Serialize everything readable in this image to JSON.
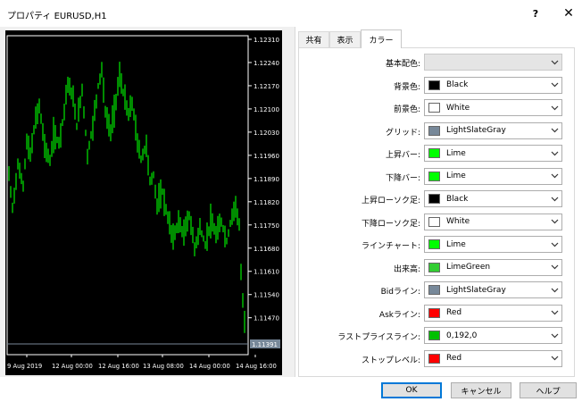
{
  "window": {
    "title": "プロパティ EURUSD,H1",
    "help_label": "?",
    "close_label": "✕"
  },
  "tabs": [
    {
      "label": "共有",
      "active": false
    },
    {
      "label": "表示",
      "active": false
    },
    {
      "label": "カラー",
      "active": true
    }
  ],
  "chart": {
    "background": "#000000",
    "bull_color": "#00ff00",
    "grid_color": "#778899",
    "price_labels": [
      "1.12310",
      "1.12240",
      "1.12170",
      "1.12100",
      "1.12030",
      "1.11960",
      "1.11890",
      "1.11820",
      "1.11750",
      "1.11680",
      "1.11610",
      "1.11540",
      "1.11470"
    ],
    "current_price": "1.11391",
    "time_labels": [
      "9 Aug 2019",
      "12 Aug 00:00",
      "12 Aug 16:00",
      "13 Aug 08:00",
      "14 Aug 00:00",
      "14 Aug 16:00"
    ]
  },
  "color_settings": [
    {
      "label": "基本配色:",
      "value": "",
      "swatch": null,
      "disabled": true
    },
    {
      "label": "背景色:",
      "value": "Black",
      "swatch": "#000000"
    },
    {
      "label": "前景色:",
      "value": "White",
      "swatch": "#ffffff"
    },
    {
      "label": "グリッド:",
      "value": "LightSlateGray",
      "swatch": "#778899"
    },
    {
      "label": "上昇バー:",
      "value": "Lime",
      "swatch": "#00ff00"
    },
    {
      "label": "下降バー:",
      "value": "Lime",
      "swatch": "#00ff00"
    },
    {
      "label": "上昇ローソク足:",
      "value": "Black",
      "swatch": "#000000"
    },
    {
      "label": "下降ローソク足:",
      "value": "White",
      "swatch": "#ffffff"
    },
    {
      "label": "ラインチャート:",
      "value": "Lime",
      "swatch": "#00ff00"
    },
    {
      "label": "出来高:",
      "value": "LimeGreen",
      "swatch": "#32cd32"
    },
    {
      "label": "Bidライン:",
      "value": "LightSlateGray",
      "swatch": "#778899"
    },
    {
      "label": "Askライン:",
      "value": "Red",
      "swatch": "#ff0000"
    },
    {
      "label": "ラストプライスライン:",
      "value": "0,192,0",
      "swatch": "#00c000"
    },
    {
      "label": "ストップレベル:",
      "value": "Red",
      "swatch": "#ff0000"
    }
  ],
  "buttons": {
    "ok": "OK",
    "cancel": "キャンセル",
    "help": "ヘルプ"
  }
}
